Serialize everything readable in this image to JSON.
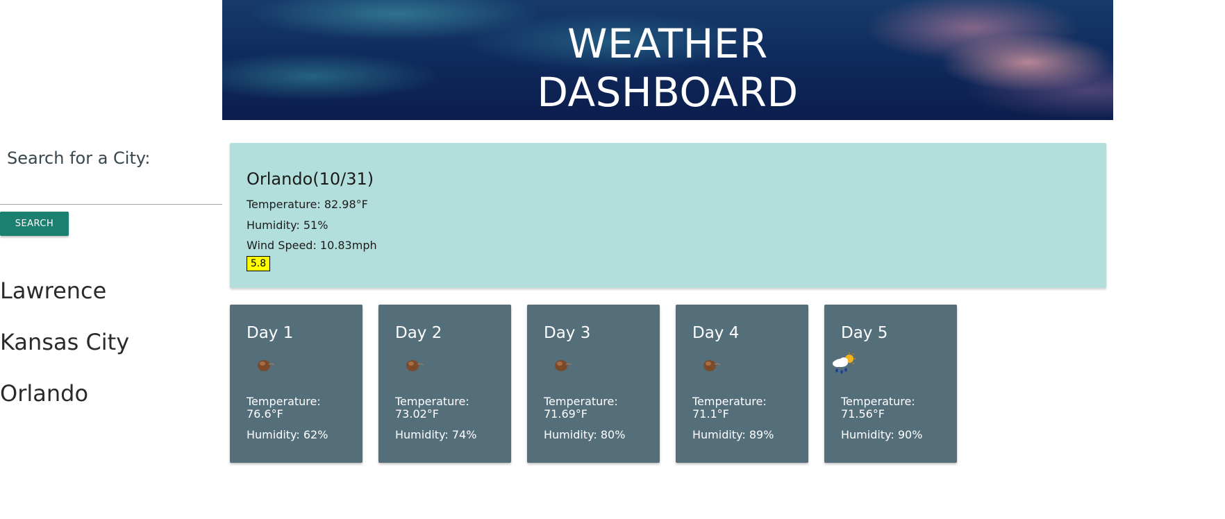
{
  "header": {
    "title_line1": "WEATHER",
    "title_line2": "DASHBOARD"
  },
  "sidebar": {
    "search_label": "Search for a City:",
    "search_value": "",
    "search_button": "SEARCH",
    "cities": [
      "Lawrence",
      "Kansas City",
      "Orlando"
    ]
  },
  "current": {
    "title": "Orlando(10/31)",
    "temperature": "Temperature: 82.98°F",
    "humidity": "Humidity: 51%",
    "wind": "Wind Speed: 10.83mph",
    "uv": "5.8",
    "uv_color": "#ffff00"
  },
  "forecast": [
    {
      "day": "Day 1",
      "icon": "dust-icon",
      "temp_label": "Temperature:",
      "temp": "76.6°F",
      "humidity": "Humidity: 62%"
    },
    {
      "day": "Day 2",
      "icon": "dust-icon",
      "temp_label": "Temperature:",
      "temp": "73.02°F",
      "humidity": "Humidity: 74%"
    },
    {
      "day": "Day 3",
      "icon": "dust-icon",
      "temp_label": "Temperature:",
      "temp": "71.69°F",
      "humidity": "Humidity: 80%"
    },
    {
      "day": "Day 4",
      "icon": "dust-icon",
      "temp_label": "Temperature:",
      "temp": "71.1°F",
      "humidity": "Humidity: 89%"
    },
    {
      "day": "Day 5",
      "icon": "rain-sun-icon",
      "temp_label": "Temperature:",
      "temp": "71.56°F",
      "humidity": "Humidity: 90%"
    }
  ],
  "colors": {
    "button": "#1b8070",
    "current_card": "#b2dfdb",
    "forecast_card": "#546e7a"
  }
}
